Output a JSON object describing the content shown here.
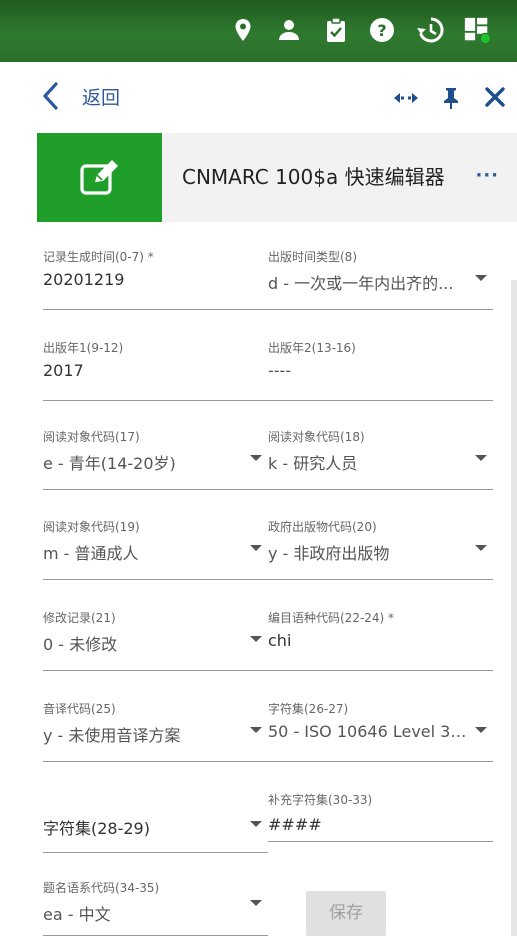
{
  "topbar": {
    "icons": [
      "location-icon",
      "user-icon",
      "clipboard-check-icon",
      "help-icon",
      "history-icon",
      "dashboard-icon"
    ],
    "accent": "#2b6f2b",
    "status_dot_color": "#1fbf2a"
  },
  "nav": {
    "back_label": "返回"
  },
  "header": {
    "title": "CNMARC 100$a 快速编辑器",
    "more": "···",
    "tile_color": "#1f9e2a"
  },
  "form": {
    "record_date": {
      "label": "记录生成时间(0-7) *",
      "value": "20201219"
    },
    "pub_date_type": {
      "label": "出版时间类型(8)",
      "value": "d - 一次或一年内出齐的..."
    },
    "pub_year1": {
      "label": "出版年1(9-12)",
      "value": "2017"
    },
    "pub_year2": {
      "label": "出版年2(13-16)",
      "value": "----"
    },
    "audience1": {
      "label": "阅读对象代码(17)",
      "value": "e - 青年(14-20岁)"
    },
    "audience2": {
      "label": "阅读对象代码(18)",
      "value": "k - 研究人员"
    },
    "audience3": {
      "label": "阅读对象代码(19)",
      "value": "m - 普通成人"
    },
    "gov_pub": {
      "label": "政府出版物代码(20)",
      "value": "y - 非政府出版物"
    },
    "modified": {
      "label": "修改记录(21)",
      "value": "0 - 未修改"
    },
    "cat_lang": {
      "label": "编目语种代码(22-24) *",
      "value": "chi"
    },
    "translit": {
      "label": "音译代码(25)",
      "value": "y - 未使用音译方案"
    },
    "charset1": {
      "label": "字符集(26-27)",
      "value": "50 - ISO 10646 Level 3(U..."
    },
    "charset2": {
      "label": "",
      "value": "字符集(28-29)"
    },
    "supp_charset": {
      "label": "补充字符集(30-33)",
      "value": "####"
    },
    "title_script": {
      "label": "题名语系代码(34-35)",
      "value": "ea - 中文"
    }
  },
  "actions": {
    "save_label": "保存"
  }
}
